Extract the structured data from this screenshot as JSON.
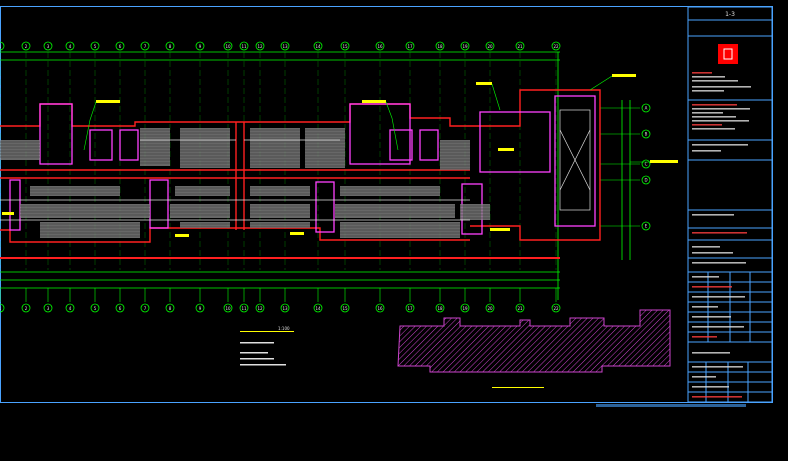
{
  "title_block": {
    "sheet_index": "1-3",
    "logo_caption": "",
    "rows": [
      "",
      "",
      "",
      "",
      "",
      "",
      "",
      "",
      "",
      "",
      "",
      ""
    ]
  },
  "notes": {
    "heading": "",
    "scale": "1:100",
    "lines": [
      "",
      "",
      "",
      ""
    ]
  },
  "keyplan": {
    "caption": ""
  },
  "bottom_bar": {
    "text": ""
  },
  "colors": {
    "wall": "#ff2020",
    "magenta": "#ff40ff",
    "grid": "#00ff00",
    "axis": "#ff3030",
    "white": "#e0e0e0",
    "yellow": "#ffff00",
    "frame": "#4aa3ff",
    "hatch": "#cc44cc"
  },
  "axis_labels_top": [
    "1",
    "2",
    "3",
    "4",
    "5",
    "6",
    "7",
    "8",
    "9",
    "10",
    "11",
    "12",
    "13",
    "14",
    "15",
    "16",
    "17",
    "18",
    "19",
    "20",
    "21",
    "22"
  ],
  "axis_labels_bottom": [
    "1",
    "2",
    "3",
    "4",
    "5",
    "6",
    "7",
    "8",
    "9",
    "10",
    "11",
    "12",
    "13",
    "14",
    "15",
    "16",
    "17",
    "18",
    "19",
    "20",
    "21",
    "22"
  ],
  "axis_labels_right": [
    "A",
    "B",
    "C",
    "D",
    "E"
  ]
}
